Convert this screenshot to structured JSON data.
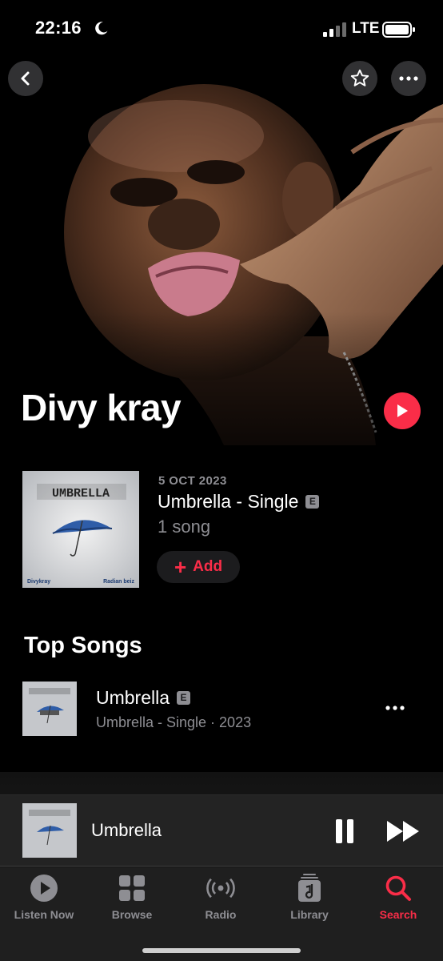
{
  "status": {
    "time": "22:16",
    "network": "LTE"
  },
  "artist": {
    "name": "Divy kray"
  },
  "latest_release": {
    "date": "5 OCT 2023",
    "title": "Umbrella - Single",
    "explicit_badge": "E",
    "count": "1 song",
    "add_label": "Add",
    "art": {
      "title": "UMBRELLA",
      "left_credit": "Divykray",
      "right_credit": "Radian beiz"
    }
  },
  "top_songs": {
    "title": "Top Songs",
    "items": [
      {
        "title": "Umbrella",
        "explicit_badge": "E",
        "subtitle": "Umbrella - Single · 2023"
      }
    ]
  },
  "now_playing": {
    "title": "Umbrella"
  },
  "tabs": [
    {
      "label": "Listen Now",
      "icon": "play-circle-icon"
    },
    {
      "label": "Browse",
      "icon": "grid-icon"
    },
    {
      "label": "Radio",
      "icon": "radio-waves-icon"
    },
    {
      "label": "Library",
      "icon": "music-note-stack-icon"
    },
    {
      "label": "Search",
      "icon": "search-icon",
      "active": true
    }
  ],
  "colors": {
    "accent": "#fa2d48",
    "secondary_text": "#8e8e93",
    "background": "#000000"
  }
}
